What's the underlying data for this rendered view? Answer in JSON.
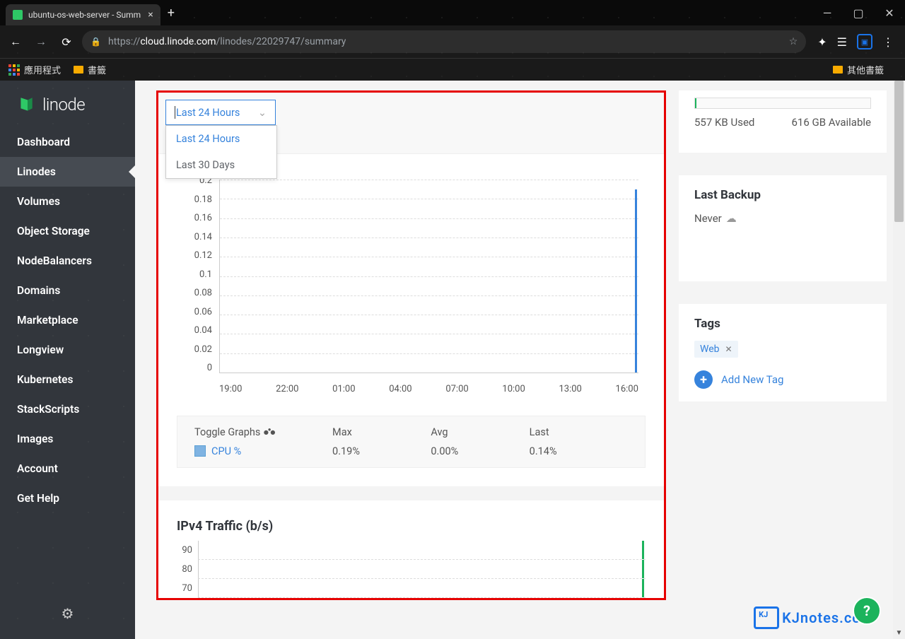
{
  "browser": {
    "tab_title": "ubuntu-os-web-server - Summ",
    "url_proto": "https://",
    "url_host": "cloud.linode.com",
    "url_path": "/linodes/22029747/summary",
    "bookmarks": {
      "apps": "應用程式",
      "bookmarks": "書籤",
      "other": "其他書籤"
    },
    "window": {
      "min": "—",
      "max": "▢",
      "close": "✕"
    }
  },
  "linode": {
    "brand": "linode",
    "sidebar": [
      "Dashboard",
      "Linodes",
      "Volumes",
      "Object Storage",
      "NodeBalancers",
      "Domains",
      "Marketplace",
      "Longview",
      "Kubernetes",
      "StackScripts",
      "Images",
      "Account",
      "Get Help"
    ],
    "active_index": 1
  },
  "dropdown": {
    "selected": "Last 24 Hours",
    "options": [
      "Last 24 Hours",
      "Last 30 Days"
    ]
  },
  "chart_data": {
    "type": "line",
    "title": "",
    "ylabel": "",
    "xlabel": "",
    "ylim": [
      0,
      0.2
    ],
    "y_ticks": [
      "0.2",
      "0.18",
      "0.16",
      "0.14",
      "0.12",
      "0.1",
      "0.08",
      "0.06",
      "0.04",
      "0.02",
      "0"
    ],
    "x_ticks": [
      "19:00",
      "22:00",
      "01:00",
      "04:00",
      "07:00",
      "10:00",
      "13:00",
      "16:00"
    ],
    "series": [
      {
        "name": "CPU %",
        "color": "#3683dc",
        "data_note": "flat near zero with spike to ~0.19 at 16:00"
      }
    ]
  },
  "legend": {
    "toggle": "Toggle Graphs",
    "columns": [
      "Max",
      "Avg",
      "Last"
    ],
    "rows": [
      {
        "label": "CPU %",
        "max": "0.19%",
        "avg": "0.00%",
        "last": "0.14%"
      }
    ]
  },
  "section2": {
    "title": "IPv4 Traffic (b/s)",
    "y_ticks": [
      "90",
      "80",
      "70"
    ]
  },
  "storage": {
    "used": "557 KB Used",
    "available": "616 GB Available"
  },
  "backup": {
    "title": "Last Backup",
    "value": "Never"
  },
  "tags": {
    "title": "Tags",
    "items": [
      "Web"
    ],
    "add": "Add New Tag"
  },
  "watermark": "KJnotes.com"
}
